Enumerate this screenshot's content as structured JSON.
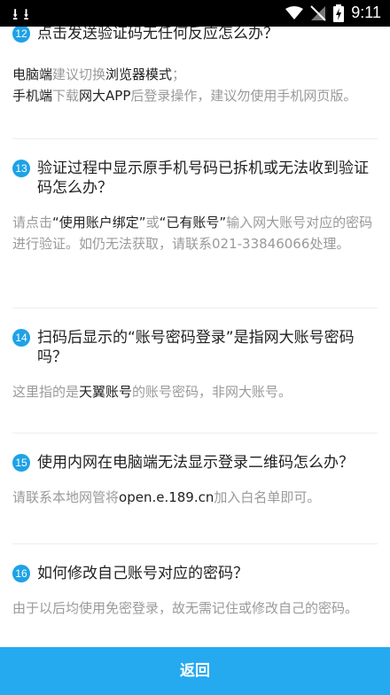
{
  "status_bar": {
    "time": "9:11"
  },
  "faq": [
    {
      "number": "12",
      "question": "点击发送验证码无任何反应怎么办？",
      "answer_line1": [
        "电脑端",
        "建议切换",
        "浏览器模式",
        "；"
      ],
      "answer_line2": [
        "手机端",
        "下载",
        "网大APP",
        "后登录操作，建议勿使用手机网页版。"
      ]
    },
    {
      "number": "13",
      "question": "验证过程中显示原手机号码已拆机或无法收到验证码怎么办？",
      "answer": [
        "请点击",
        "“使用账户绑定”",
        "或",
        "“已有账号”",
        "输入网大账号对应的密码进行验证。如仍无法获取，请联系021-33846066处理。"
      ]
    },
    {
      "number": "14",
      "question": "扫码后显示的“账号密码登录”是指网大账号密码吗？",
      "answer": [
        "这里指的是",
        "天翼账号",
        "的账号密码，非网大账号。"
      ]
    },
    {
      "number": "15",
      "question": "使用内网在电脑端无法显示登录二维码怎么办？",
      "answer": [
        "请联系本地网管将",
        "open.e.189.cn",
        "加入白名单即可。"
      ]
    },
    {
      "number": "16",
      "question": "如何修改自己账号对应的密码？",
      "answer": [
        "由于以后均使用免密登录，故无需记住或修改自己的密码。"
      ]
    }
  ],
  "footer": {
    "back_label": "返回"
  }
}
